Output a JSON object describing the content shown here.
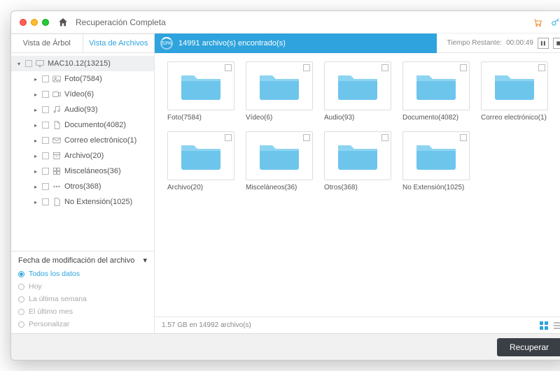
{
  "window_title": "Recuperación Completa",
  "sidebar": {
    "tabs": {
      "tree": "Vista de Árbol",
      "file": "Vista de Archivos"
    },
    "root": {
      "label": "MAC10.12(13215)"
    },
    "items": [
      {
        "label": "Foto(7584)"
      },
      {
        "label": "Vídeo(6)"
      },
      {
        "label": "Audio(93)"
      },
      {
        "label": "Documento(4082)"
      },
      {
        "label": "Correo electrónico(1)"
      },
      {
        "label": "Archivo(20)"
      },
      {
        "label": "Misceláneos(36)"
      },
      {
        "label": "Otros(368)"
      },
      {
        "label": "No Extensión(1025)"
      }
    ],
    "filter_title": "Fecha de modificación del archivo",
    "filters": [
      "Todos los datos",
      "Hoy",
      "La última semana",
      "El último mes",
      "Personalizar"
    ]
  },
  "progress": {
    "pct": "53%",
    "msg": "14991 archivo(s) encontrado(s)"
  },
  "time": {
    "label": "Tiempo Restante:",
    "value": "00:00:49"
  },
  "folders": [
    "Foto(7584)",
    "Vídeo(6)",
    "Audio(93)",
    "Documento(4082)",
    "Correo electrónico(1)",
    "Archivo(20)",
    "Misceláneos(36)",
    "Otros(368)",
    "No Extensión(1025)"
  ],
  "status": "1.57 GB en 14992 archivo(s)",
  "action": "Recuperar"
}
